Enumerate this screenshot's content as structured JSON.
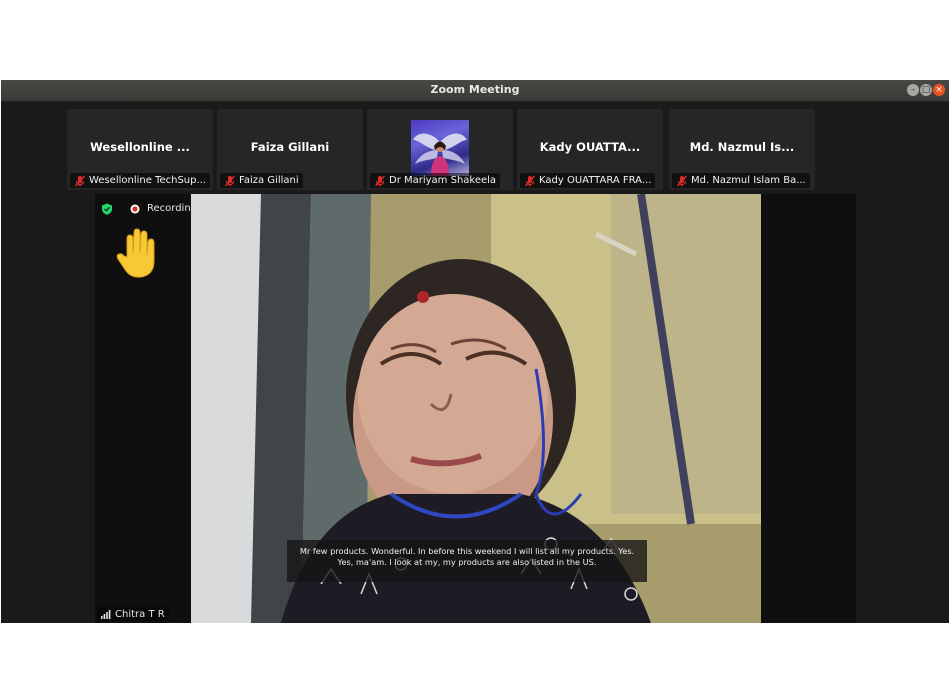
{
  "window": {
    "title": "Zoom Meeting",
    "controls": [
      "minimize-icon",
      "maximize-icon",
      "close-icon"
    ]
  },
  "strip": [
    {
      "name": "Wesellonline ...",
      "label": "Wesellonline TechSup...",
      "has_image": false
    },
    {
      "name": "Faiza Gillani",
      "label": "Faiza Gillani",
      "has_image": false
    },
    {
      "name": "",
      "label": "Dr Mariyam Shakeela",
      "has_image": true
    },
    {
      "name": "Kady OUATTA...",
      "label": "Kady OUATTARA FRA...",
      "has_image": false
    },
    {
      "name": "Md. Nazmul Is...",
      "label": "Md. Nazmul Islam Ba...",
      "has_image": false
    }
  ],
  "main": {
    "recording_text": "Recording",
    "speaker_name": "Chitra T R",
    "caption": "Mr few products. Wonderful. In before this weekend I will list all my products. Yes. Yes, ma'am. I look at my, my products are also listed in the US."
  },
  "colors": {
    "window_bg": "#1a1a1a",
    "tile_bg": "#262626",
    "titlebar": "#3d3c39",
    "close_button": "#e95420",
    "muted_icon": "#e02b2b",
    "shield_icon": "#23d96c",
    "raised_hand": "#f7c934"
  }
}
